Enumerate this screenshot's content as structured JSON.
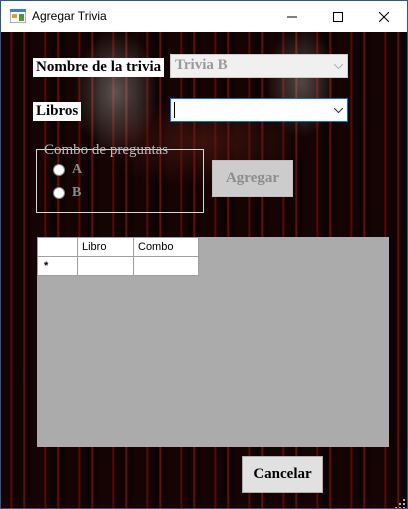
{
  "window": {
    "title": "Agregar Trivia",
    "controls": {
      "minimize": "minimize-icon",
      "maximize": "maximize-icon",
      "close": "close-icon"
    }
  },
  "form": {
    "trivia_label": "Nombre de la trivia",
    "trivia_value": "Trivia B",
    "libros_label": "Libros",
    "libros_value": "",
    "group_title": "Combo de preguntas",
    "option_a": "A",
    "option_b": "B",
    "add_button": "Agregar",
    "cancel_button": "Cancelar"
  },
  "grid": {
    "columns": [
      "Libro",
      "Combo"
    ],
    "new_row_marker": "*"
  },
  "colors": {
    "accent": "#0078d7",
    "grid_background": "#ababab"
  }
}
